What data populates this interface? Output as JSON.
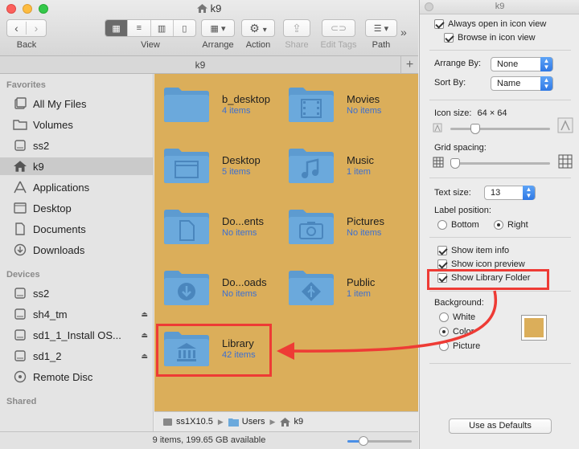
{
  "window": {
    "title": "k9",
    "tab_title": "k9",
    "tab_add": "+"
  },
  "toolbar": {
    "back_label": "Back",
    "view_label": "View",
    "arrange_label": "Arrange",
    "action_label": "Action",
    "share_label": "Share",
    "edit_tags_label": "Edit Tags",
    "path_label": "Path",
    "overflow": "»"
  },
  "sidebar": {
    "favorites_heading": "Favorites",
    "favorites": [
      {
        "label": "All My Files",
        "icon": "all-files-icon"
      },
      {
        "label": "Volumes",
        "icon": "folder-icon"
      },
      {
        "label": "ss2",
        "icon": "drive-icon"
      },
      {
        "label": "k9",
        "icon": "home-icon",
        "selected": true
      },
      {
        "label": "Applications",
        "icon": "applications-icon"
      },
      {
        "label": "Desktop",
        "icon": "desktop-icon"
      },
      {
        "label": "Documents",
        "icon": "documents-icon"
      },
      {
        "label": "Downloads",
        "icon": "downloads-icon"
      }
    ],
    "devices_heading": "Devices",
    "devices": [
      {
        "label": "ss2",
        "icon": "drive-icon"
      },
      {
        "label": "sh4_tm",
        "icon": "drive-icon",
        "eject": true
      },
      {
        "label": "sd1_1_Install OS...",
        "icon": "drive-icon",
        "eject": true
      },
      {
        "label": "sd1_2",
        "icon": "drive-icon",
        "eject": true
      },
      {
        "label": "Remote Disc",
        "icon": "disc-icon"
      }
    ],
    "shared_heading": "Shared"
  },
  "items": [
    {
      "name": "b_desktop",
      "count": "4 items",
      "glyph": "blank"
    },
    {
      "name": "Movies",
      "count": "No items",
      "glyph": "movie"
    },
    {
      "name": "Desktop",
      "count": "5 items",
      "glyph": "desktop"
    },
    {
      "name": "Music",
      "count": "1 item",
      "glyph": "music"
    },
    {
      "name": "Do...ents",
      "count": "No items",
      "glyph": "document"
    },
    {
      "name": "Pictures",
      "count": "No items",
      "glyph": "camera"
    },
    {
      "name": "Do...oads",
      "count": "No items",
      "glyph": "download"
    },
    {
      "name": "Public",
      "count": "1 item",
      "glyph": "public"
    },
    {
      "name": "Library",
      "count": "42 items",
      "glyph": "library"
    }
  ],
  "pathbar": {
    "segments": [
      "ss1X10.5",
      "Users",
      "k9"
    ],
    "separator": "▶"
  },
  "status": {
    "text": "9 items, 199.65 GB available",
    "zoom_fraction": 0.25
  },
  "panel": {
    "title": "k9",
    "always_open": "Always open in icon view",
    "browse": "Browse in icon view",
    "arrange_by_label": "Arrange By:",
    "arrange_by_value": "None",
    "sort_by_label": "Sort By:",
    "sort_by_value": "Name",
    "icon_size_label": "Icon size:",
    "icon_size_value": "64 × 64",
    "icon_size_fraction": 0.25,
    "grid_spacing_label": "Grid spacing:",
    "grid_spacing_fraction": 0.05,
    "text_size_label": "Text size:",
    "text_size_value": "13",
    "label_position_label": "Label position:",
    "label_bottom": "Bottom",
    "label_right": "Right",
    "show_item_info": "Show item info",
    "show_icon_preview": "Show icon preview",
    "show_library": "Show Library Folder",
    "background_label": "Background:",
    "bg_white": "White",
    "bg_color": "Color",
    "bg_picture": "Picture",
    "use_defaults": "Use as Defaults"
  },
  "colors": {
    "background": "#dbae5a",
    "folder": "#6ba9dc",
    "folder_tab": "#5d9bd0",
    "highlight": "#ee3b35",
    "count_text": "#3c6fd1"
  }
}
